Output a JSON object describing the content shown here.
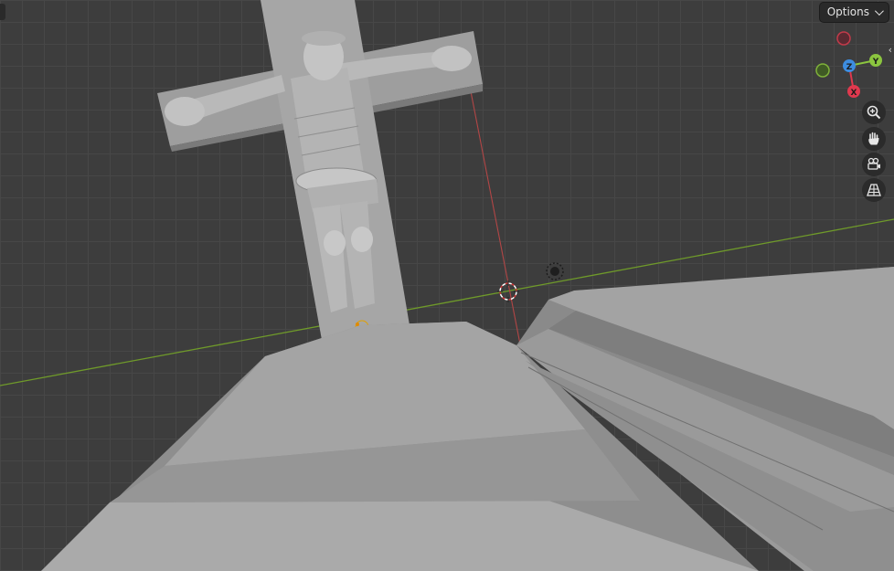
{
  "header": {
    "options_label": "Options"
  },
  "gizmo": {
    "x_label": "X",
    "y_label": "Y",
    "z_label": "Z",
    "colors": {
      "x": "#e0394e",
      "y": "#8bc53f",
      "z": "#3d8de0"
    }
  },
  "nav_tools": [
    {
      "icon": "zoom-icon"
    },
    {
      "icon": "pan-hand-icon"
    },
    {
      "icon": "camera-view-icon"
    },
    {
      "icon": "perspective-grid-icon"
    }
  ],
  "viewport": {
    "axis_colors": {
      "x_axis": "#c84a4a",
      "y_axis": "#6f9a2a"
    },
    "objects": [
      "crucifix",
      "book-base-left",
      "book-base-right"
    ]
  }
}
